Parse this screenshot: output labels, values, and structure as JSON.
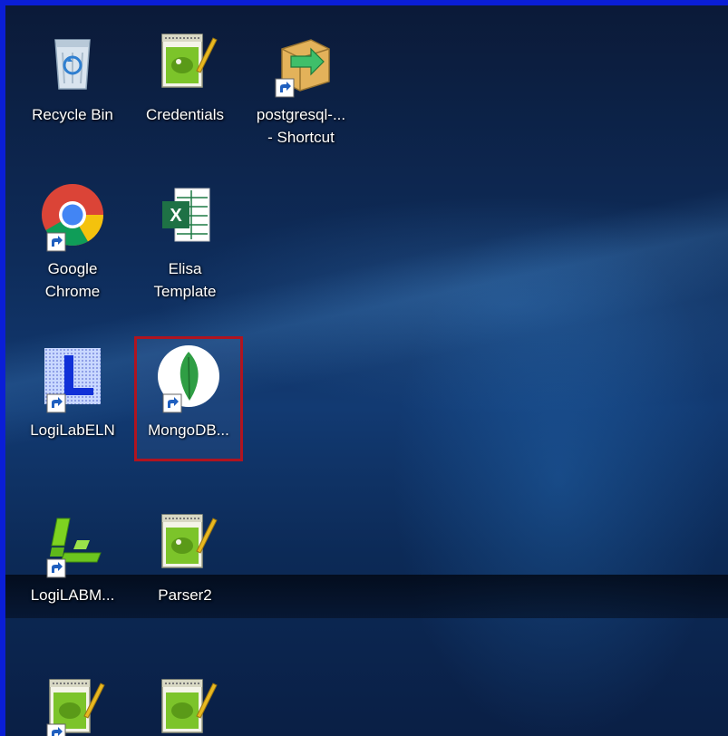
{
  "desktop": {
    "icons": [
      {
        "id": "recycle-bin",
        "label": "Recycle Bin",
        "label2": "",
        "shortcut": false
      },
      {
        "id": "credentials",
        "label": "Credentials",
        "label2": "",
        "shortcut": false
      },
      {
        "id": "postgresql",
        "label": "postgresql-...",
        "label2": "- Shortcut",
        "shortcut": true
      },
      {
        "id": "google-chrome",
        "label": "Google",
        "label2": "Chrome",
        "shortcut": true
      },
      {
        "id": "elisa-template",
        "label": "Elisa",
        "label2": "Template",
        "shortcut": false
      },
      {
        "id": "logilabeln",
        "label": "LogiLabELN",
        "label2": "",
        "shortcut": true
      },
      {
        "id": "mongodb",
        "label": "MongoDB...",
        "label2": "",
        "shortcut": true,
        "selected": true
      },
      {
        "id": "logilabm",
        "label": "LogiLABM...",
        "label2": "",
        "shortcut": true
      },
      {
        "id": "parser2",
        "label": "Parser2",
        "label2": "",
        "shortcut": false
      },
      {
        "id": "notepad-file-a",
        "label": "",
        "label2": "",
        "shortcut": true
      },
      {
        "id": "notepad-file-b",
        "label": "",
        "label2": "",
        "shortcut": false
      }
    ]
  },
  "colors": {
    "window_border": "#0a1ed6",
    "selection_border": "#b01420"
  }
}
